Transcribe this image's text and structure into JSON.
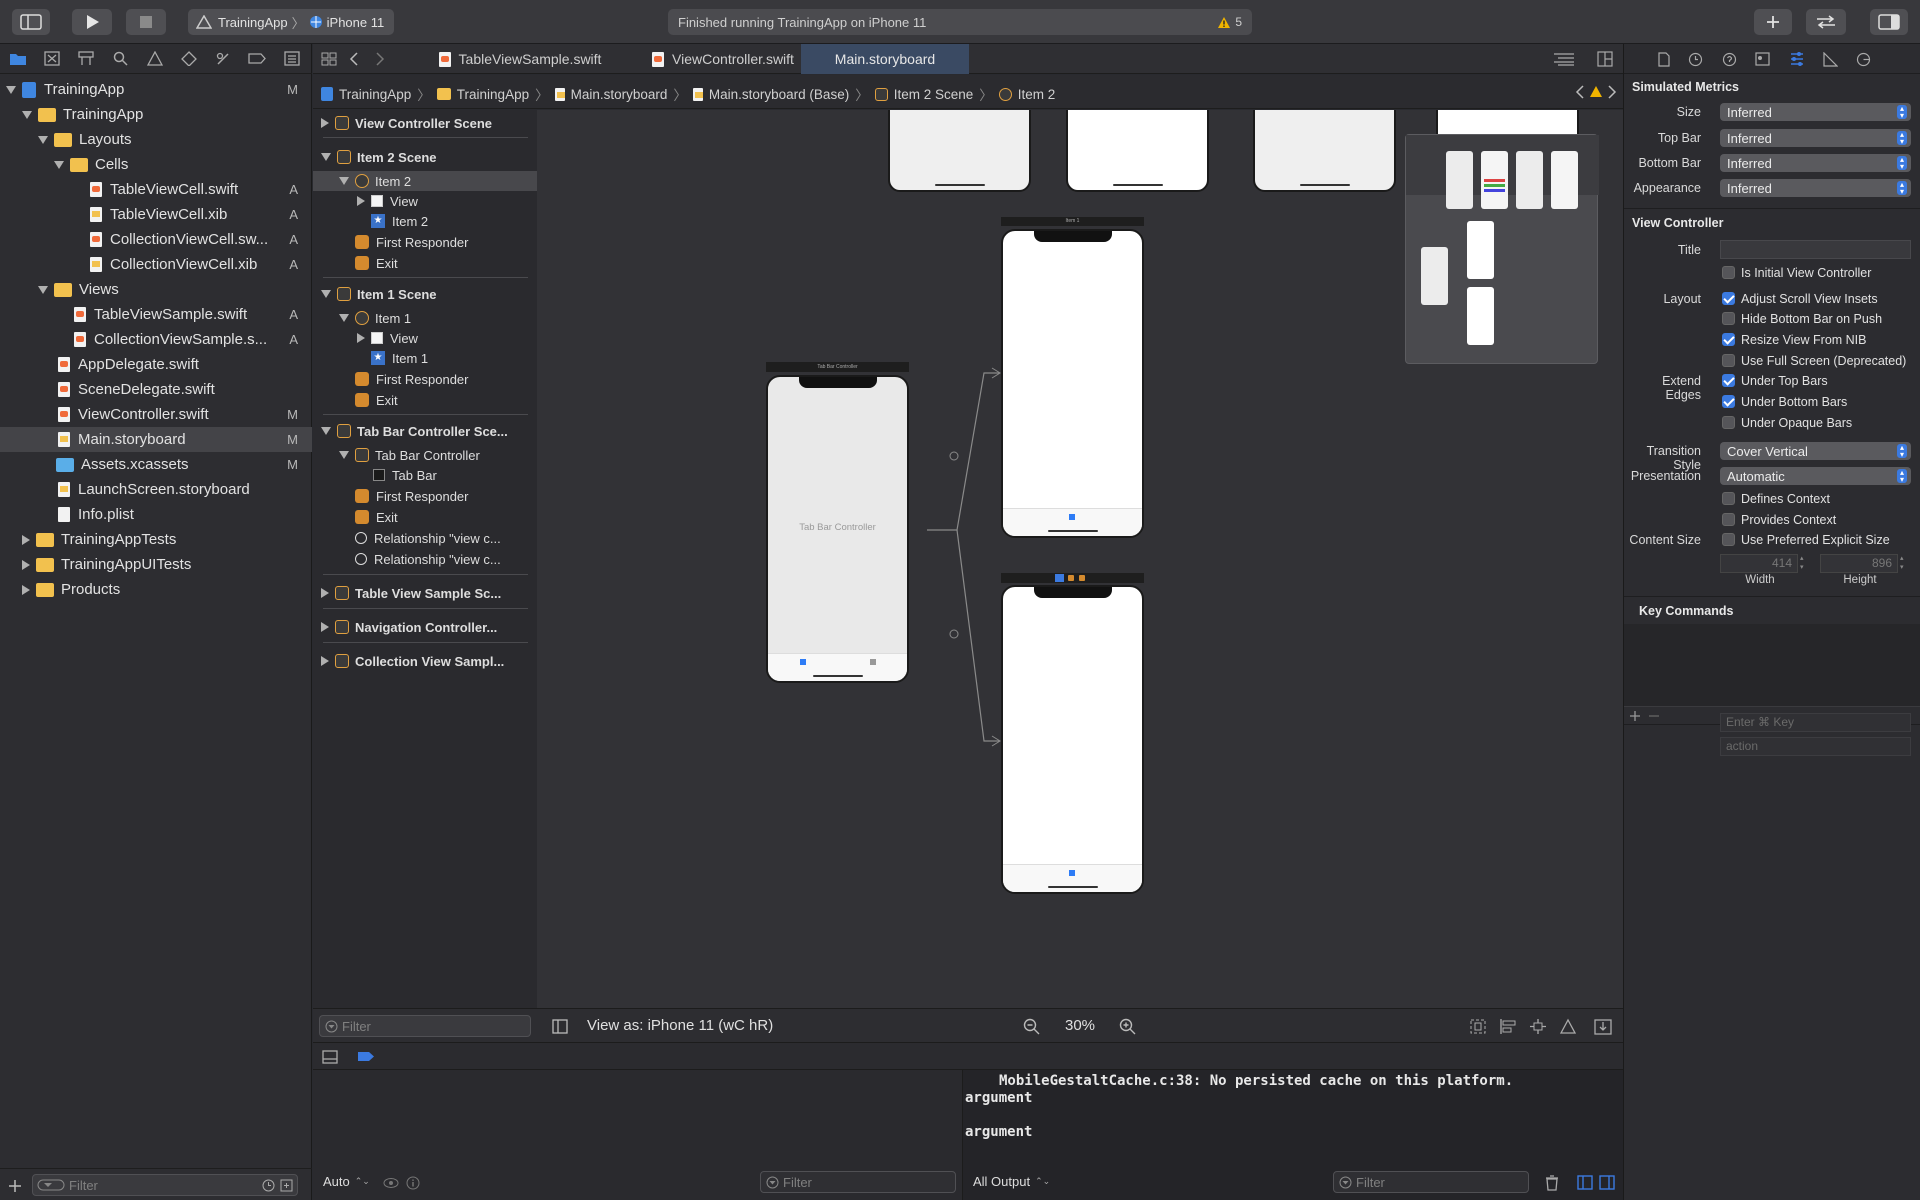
{
  "toolbar": {
    "scheme": "TrainingApp",
    "device": "iPhone 11",
    "activity_status": "Finished running TrainingApp on iPhone 11",
    "warning_count": "5"
  },
  "navigator": {
    "items": [
      {
        "label": "TrainingApp",
        "badge": "M"
      },
      {
        "label": "TrainingApp",
        "badge": ""
      },
      {
        "label": "Layouts",
        "badge": ""
      },
      {
        "label": "Cells",
        "badge": ""
      },
      {
        "label": "TableViewCell.swift",
        "badge": "A"
      },
      {
        "label": "TableViewCell.xib",
        "badge": "A"
      },
      {
        "label": "CollectionViewCell.sw...",
        "badge": "A"
      },
      {
        "label": "CollectionViewCell.xib",
        "badge": "A"
      },
      {
        "label": "Views",
        "badge": ""
      },
      {
        "label": "TableViewSample.swift",
        "badge": "A"
      },
      {
        "label": "CollectionViewSample.s...",
        "badge": "A"
      },
      {
        "label": "AppDelegate.swift",
        "badge": ""
      },
      {
        "label": "SceneDelegate.swift",
        "badge": ""
      },
      {
        "label": "ViewController.swift",
        "badge": "M"
      },
      {
        "label": "Main.storyboard",
        "badge": "M"
      },
      {
        "label": "Assets.xcassets",
        "badge": "M"
      },
      {
        "label": "LaunchScreen.storyboard",
        "badge": ""
      },
      {
        "label": "Info.plist",
        "badge": ""
      },
      {
        "label": "TrainingAppTests",
        "badge": ""
      },
      {
        "label": "TrainingAppUITests",
        "badge": ""
      },
      {
        "label": "Products",
        "badge": ""
      }
    ],
    "filter_placeholder": "Filter"
  },
  "tabs": [
    {
      "label": "TableViewSample.swift"
    },
    {
      "label": "ViewController.swift"
    },
    {
      "label": "Main.storyboard"
    }
  ],
  "jumpbar": [
    "TrainingApp",
    "TrainingApp",
    "Main.storyboard",
    "Main.storyboard (Base)",
    "Item 2 Scene",
    "Item 2"
  ],
  "outline": {
    "items": [
      "View Controller Scene",
      "Item 2 Scene",
      "Item 2",
      "View",
      "Item 2",
      "First Responder",
      "Exit",
      "Item 1 Scene",
      "Item 1",
      "View",
      "Item 1",
      "First Responder",
      "Exit",
      "Tab Bar Controller Sce...",
      "Tab Bar Controller",
      "Tab Bar",
      "First Responder",
      "Exit",
      "Relationship \"view c...",
      "Relationship \"view c...",
      "Table View Sample Sc...",
      "Navigation Controller...",
      "Collection View Sampl..."
    ],
    "filter_placeholder": "Filter"
  },
  "canvas": {
    "tab_bar_controller_label": "Tab Bar Controller",
    "tab_bar_controller_title": "Tab Bar Controller",
    "item1_title": "Item 1",
    "view_as": "View as: iPhone 11 (wC hR)",
    "zoom": "30%"
  },
  "console": {
    "lines": [
      "MobileGestaltCache.c:38: No persisted cache on this platform.",
      "argument",
      "",
      "argument"
    ],
    "output_selector": "All Output",
    "vars_mode": "Auto",
    "filter_placeholder": "Filter"
  },
  "inspector": {
    "simulated_metrics": {
      "header": "Simulated Metrics",
      "rows": [
        {
          "label": "Size",
          "value": "Inferred"
        },
        {
          "label": "Top Bar",
          "value": "Inferred"
        },
        {
          "label": "Bottom Bar",
          "value": "Inferred"
        },
        {
          "label": "Appearance",
          "value": "Inferred"
        }
      ]
    },
    "view_controller": {
      "header": "View Controller",
      "title_label": "Title",
      "title_value": "",
      "is_initial": "Is Initial View Controller",
      "layout_label": "Layout",
      "layout_options": [
        {
          "label": "Adjust Scroll View Insets",
          "checked": true
        },
        {
          "label": "Hide Bottom Bar on Push",
          "checked": false
        },
        {
          "label": "Resize View From NIB",
          "checked": true
        },
        {
          "label": "Use Full Screen (Deprecated)",
          "checked": false
        }
      ],
      "extend_label": "Extend Edges",
      "extend_options": [
        {
          "label": "Under Top Bars",
          "checked": true
        },
        {
          "label": "Under Bottom Bars",
          "checked": true
        },
        {
          "label": "Under Opaque Bars",
          "checked": false
        }
      ],
      "transition_label": "Transition Style",
      "transition_value": "Cover Vertical",
      "presentation_label": "Presentation",
      "presentation_value": "Automatic",
      "defines_context": "Defines Context",
      "provides_context": "Provides Context",
      "content_size_label": "Content Size",
      "preferred_size": "Use Preferred Explicit Size",
      "width_value": "414",
      "height_value": "896",
      "width_label": "Width",
      "height_label": "Height"
    },
    "key_commands": {
      "header": "Key Commands",
      "key_placeholder": "Enter ⌘ Key",
      "action_placeholder": "action"
    }
  }
}
